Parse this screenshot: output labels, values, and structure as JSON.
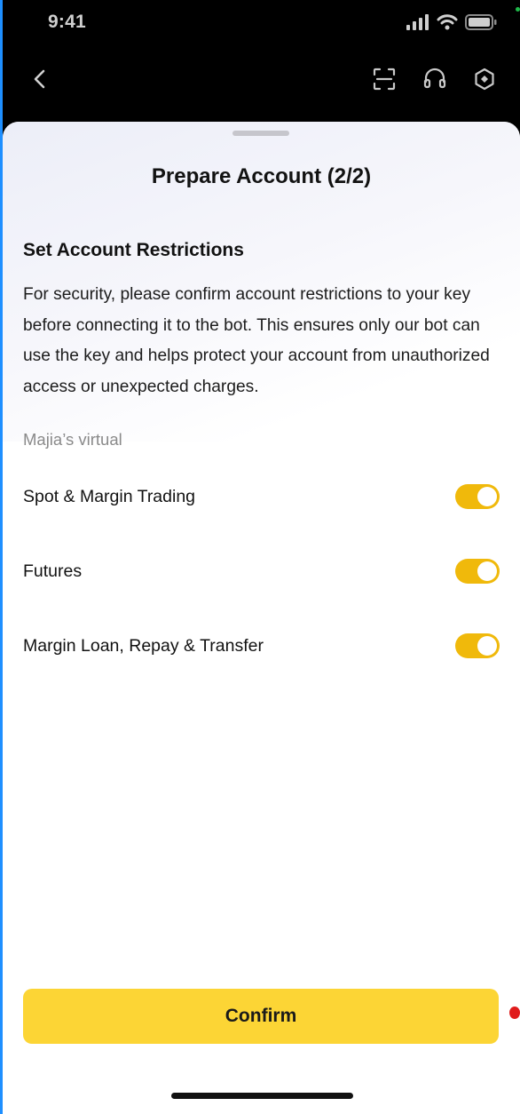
{
  "status_bar": {
    "time": "9:41"
  },
  "nav": {
    "back_icon": "chevron-left-icon",
    "scan_icon": "scan-icon",
    "support_icon": "headset-icon",
    "settings_icon": "hexagon-settings-icon"
  },
  "sheet": {
    "title": "Prepare Account (2/2)",
    "section_heading": "Set Account Restrictions",
    "description": "For security, please confirm account restrictions to your key before connecting it to the bot. This ensures only our bot can use the key and helps protect your account from unauthorized access or unexpected charges.",
    "account_name": "Majia’s virtual",
    "restrictions": [
      {
        "label": "Spot & Margin Trading",
        "enabled": true
      },
      {
        "label": "Futures",
        "enabled": true
      },
      {
        "label": "Margin Loan, Repay & Transfer",
        "enabled": true
      }
    ],
    "confirm_label": "Confirm"
  },
  "colors": {
    "accent": "#fcd535",
    "toggle_on": "#f0b90b",
    "text_primary": "#121212",
    "text_secondary": "#8a8a8a"
  }
}
